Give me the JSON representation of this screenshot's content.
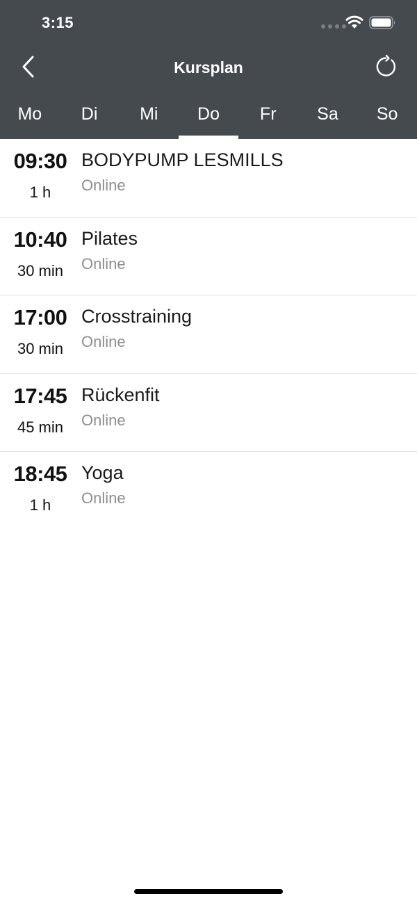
{
  "status_bar": {
    "time": "3:15"
  },
  "nav": {
    "title": "Kursplan",
    "back_icon": "chevron-left-icon",
    "refresh_icon": "refresh-icon"
  },
  "days": [
    {
      "label": "Mo",
      "active": false
    },
    {
      "label": "Di",
      "active": false
    },
    {
      "label": "Mi",
      "active": false
    },
    {
      "label": "Do",
      "active": true
    },
    {
      "label": "Fr",
      "active": false
    },
    {
      "label": "Sa",
      "active": false
    },
    {
      "label": "So",
      "active": false
    }
  ],
  "courses": [
    {
      "time": "09:30",
      "duration": "1 h",
      "name": "BODYPUMP LESMILLS",
      "location": "Online"
    },
    {
      "time": "10:40",
      "duration": "30 min",
      "name": "Pilates",
      "location": "Online"
    },
    {
      "time": "17:00",
      "duration": "30 min",
      "name": "Crosstraining",
      "location": "Online"
    },
    {
      "time": "17:45",
      "duration": "45 min",
      "name": "Rückenfit",
      "location": "Online"
    },
    {
      "time": "18:45",
      "duration": "1 h",
      "name": "Yoga",
      "location": "Online"
    }
  ],
  "colors": {
    "header_bg": "#454a4f",
    "accent": "#ffffff",
    "secondary_text": "#8e8e8e"
  }
}
